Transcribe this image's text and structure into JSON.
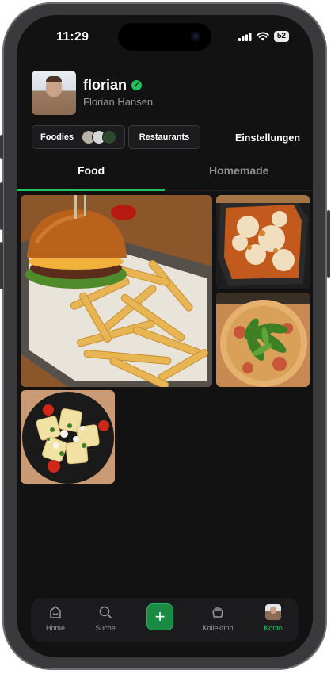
{
  "status_bar": {
    "time": "11:29",
    "battery": "52"
  },
  "profile": {
    "username": "florian",
    "full_name": "Florian Hansen",
    "verified_symbol": "✓"
  },
  "actions": {
    "foodies_label": "Foodies",
    "restaurants_label": "Restaurants",
    "settings_label": "Einstellungen"
  },
  "tabs": [
    {
      "label": "Food",
      "active": true
    },
    {
      "label": "Homemade",
      "active": false
    }
  ],
  "grid": [
    {
      "name": "burger-fries-photo"
    },
    {
      "name": "lasagna-photo"
    },
    {
      "name": "arugula-pizza-photo"
    },
    {
      "name": "ravioli-photo"
    }
  ],
  "bottom_nav": {
    "home": "Home",
    "search": "Suche",
    "add_symbol": "+",
    "collection": "Kollektion",
    "account": "Konto"
  },
  "colors": {
    "accent": "#1ec45b",
    "background": "#121212",
    "surface": "#1c1c1e"
  }
}
